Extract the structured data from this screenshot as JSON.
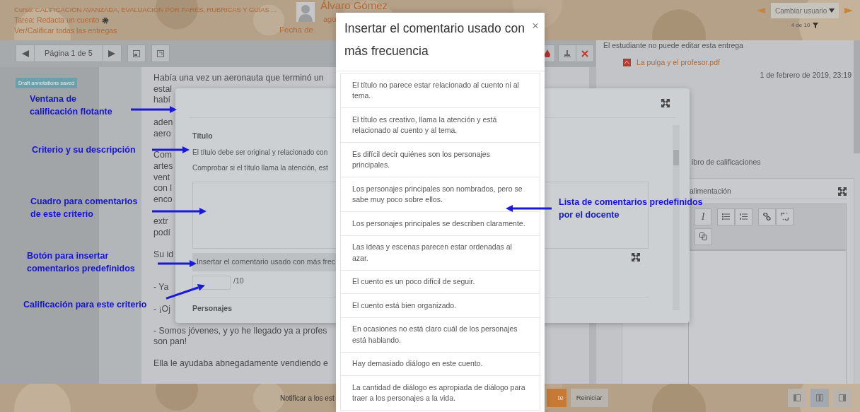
{
  "header": {
    "course": "Curso: CALIFICACION AVANZADA, EVALUACION POR PARES, RUBRICAS Y GUIAS ...",
    "assignment": "Tarea: Redacta un cuento",
    "view_all": "Ver/Calificar todas las entregas",
    "user_name": "Álvaro Gómez",
    "user_line_2": "ago",
    "due_label": "Fecha de",
    "switch_user": {
      "placeholder": "Cambiar usuario"
    },
    "counter": "4 de 10"
  },
  "pdf_toolbar": {
    "page_label": "Página 1 de 5"
  },
  "annotation_badge": "Draft annotations saved",
  "document_paragraphs": [
    [
      {
        "kind": "text",
        "text": "Había una vez un aeronauta que terminó un"
      },
      {
        "kind": "text",
        "text": "estal"
      },
      {
        "kind": "text",
        "text": "habí"
      },
      {
        "kind": "covered"
      },
      {
        "kind": "text",
        "text": "aden"
      },
      {
        "kind": "text",
        "text": "aero"
      }
    ],
    [
      {
        "kind": "text",
        "text": "Com"
      },
      {
        "kind": "text",
        "text": "artes"
      },
      {
        "kind": "text",
        "text": "vent"
      },
      {
        "kind": "text",
        "text": "con l"
      },
      {
        "kind": "text",
        "text": "enco"
      },
      {
        "kind": "covered"
      },
      {
        "kind": "text",
        "text": "extr"
      },
      {
        "kind": "text",
        "text": "podí"
      }
    ],
    [
      {
        "kind": "text",
        "text": "Su id"
      },
      {
        "kind": "covered"
      }
    ],
    [
      {
        "kind": "text",
        "text": "- Ya"
      }
    ],
    [
      {
        "kind": "text",
        "text": "- ¡Oj"
      }
    ],
    [
      {
        "kind": "text",
        "text": "- Somos jóvenes, y yo he llegado ya a profes"
      },
      {
        "kind": "text",
        "text": "son pan!"
      }
    ],
    [
      {
        "kind": "text",
        "text": "Ella le ayudaba abnegadamente vendiendo e"
      }
    ]
  ],
  "submission": {
    "status": "El estudiante no puede editar esta entrega",
    "file": "La pulga y el profesor.pdf",
    "date": "1 de febrero de 2019, 23:19",
    "gradebook_link": "ibro de calificaciones",
    "feedback_label": "alimentación",
    "italic_button": "I"
  },
  "grading_window": {
    "criterion_title": "Título",
    "description_lines": [
      "El título debe ser original y relacionado con",
      "Comprobar si el título llama la atención, est"
    ],
    "insert_button": "Insertar el comentario usado con más frec",
    "score_suffix": "/10",
    "next_criterion": "Personajes"
  },
  "footer": {
    "notify_label": "Notificar a los est",
    "save_button": "te",
    "reset_button": "Reiniciar",
    "layout_modes": [
      {
        "selected": false
      },
      {
        "selected": true
      },
      {
        "selected": false
      }
    ]
  },
  "modal": {
    "title": "Insertar el comentario usado con más frecuencia",
    "close": "×",
    "comments": [
      "El título no parece estar relacionado al cuento ni al tema.",
      "El título es creativo, llama la atención y está relacionado al cuento y al tema.",
      "Es difícil decir quiénes son los personajes principales.",
      "Los personajes principales son nombrados, pero se sabe muy poco sobre ellos.",
      "Los personajes principales se describen claramente.",
      "Las ideas y escenas parecen estar ordenadas al azar.",
      "El cuento es un poco difícil de seguir.",
      "El cuento está bien organizado.",
      "En ocasiones no está claro cuál de los personajes está hablando.",
      "Hay demasiado diálogo en este cuento.",
      "La cantidad de diálogo es apropiada de diálogo para traer a los personajes a la vida."
    ]
  },
  "annotations": [
    {
      "lines": [
        "Ventana de",
        "calificación flotante"
      ]
    },
    {
      "lines": [
        "Criterio y su descripción"
      ]
    },
    {
      "lines": [
        "Cuadro para comentarios",
        "de este criterio"
      ]
    },
    {
      "lines": [
        "Botón para insertar",
        "comentarios predefinidos"
      ]
    },
    {
      "lines": [
        "Calificación para este criterio"
      ]
    },
    {
      "lines": [
        "Lista de comentarios predefinidos",
        "por el docente"
      ]
    }
  ]
}
